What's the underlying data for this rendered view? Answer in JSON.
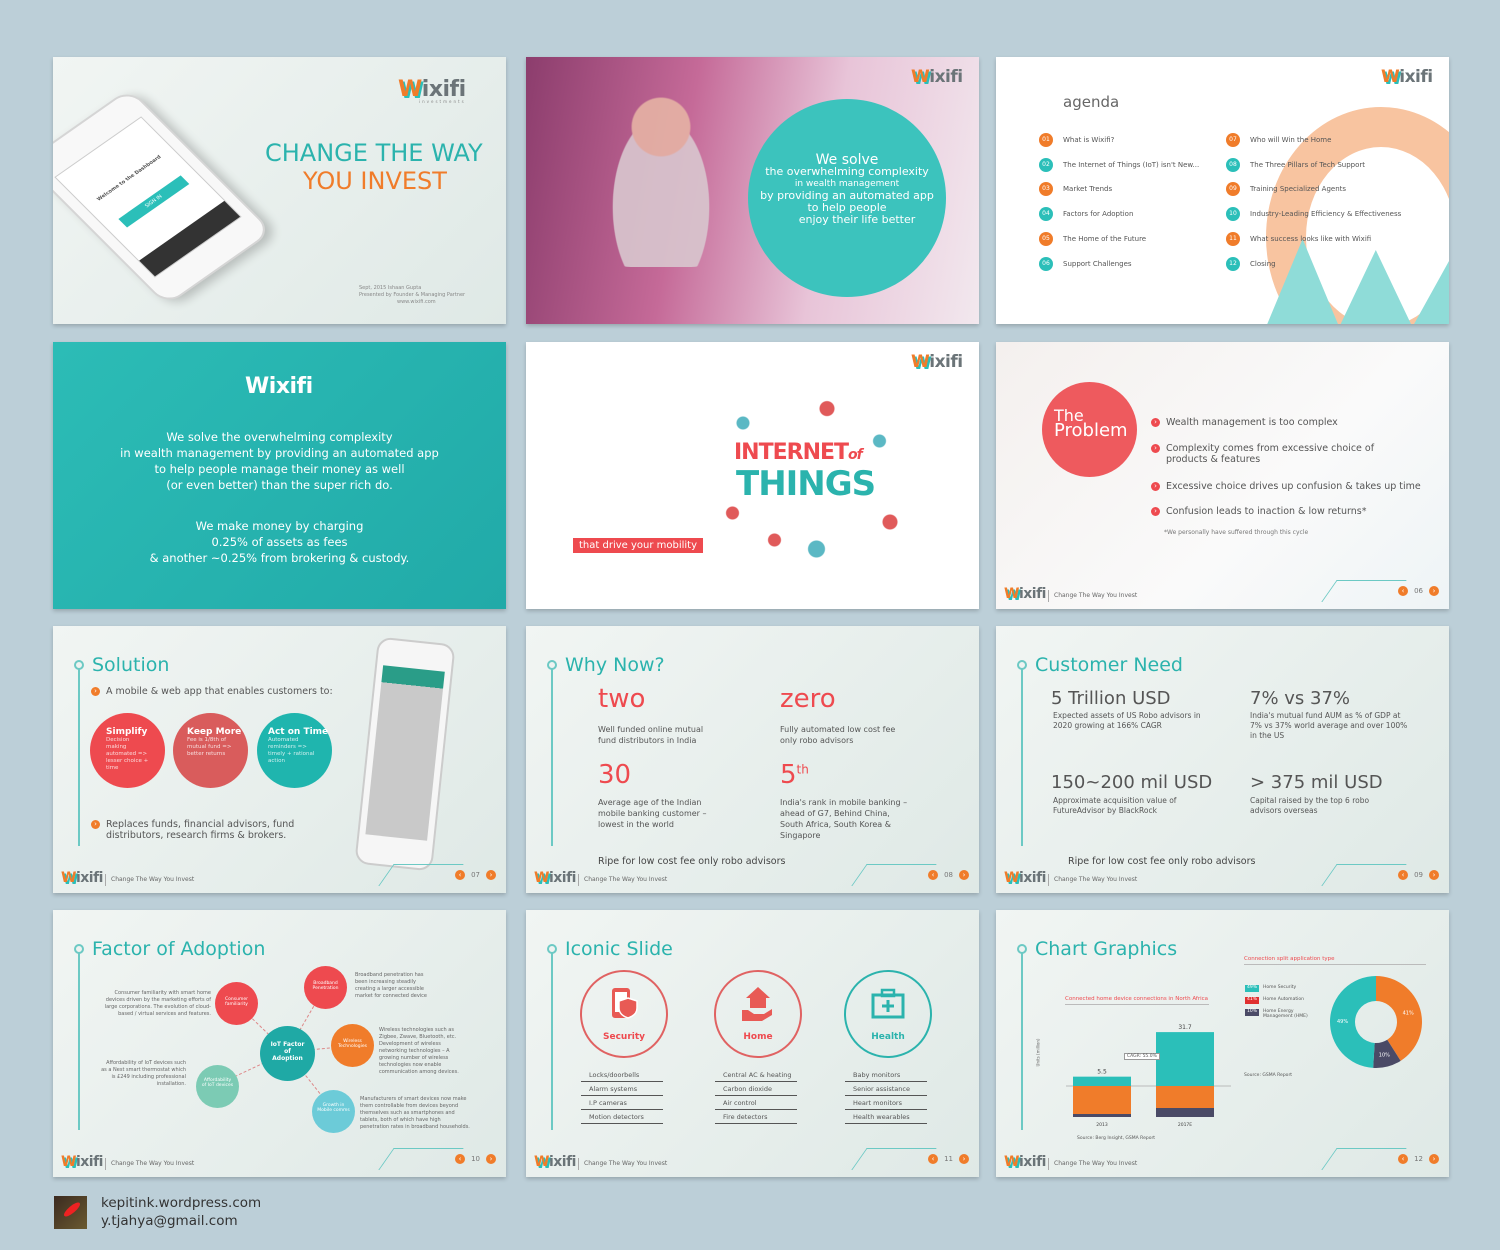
{
  "brand": {
    "logo_w": "W",
    "logo_rest": "ixifi",
    "logo_sub": "investments",
    "tagline": "Change The Way You Invest",
    "prev": "‹",
    "next": "›"
  },
  "colors": {
    "teal": "#2bb3ad",
    "orange": "#f07c2a",
    "red": "#ee4a4f",
    "navy": "#4a4a66"
  },
  "s1": {
    "title1": "CHANGE THE WAY",
    "title2": "YOU INVEST",
    "date": "Sept, 2015",
    "presented_by": "Presented by",
    "presenter": "Ishaan Gupta",
    "role": "Founder & Managing Partner",
    "url": "www.wixifi.com",
    "phone_welcome": "Welcome to the Dashboard",
    "phone_signin": "SIGN IN"
  },
  "s2": {
    "lines": [
      "We solve",
      "the overwhelming complexity",
      "in wealth management",
      "by providing an automated app",
      "to help people",
      "enjoy their life better"
    ]
  },
  "s3": {
    "title": "agenda",
    "items": [
      {
        "n": "01",
        "t": "What is Wixifi?"
      },
      {
        "n": "02",
        "t": "The Internet of Things (IoT) isn't New..."
      },
      {
        "n": "03",
        "t": "Market Trends"
      },
      {
        "n": "04",
        "t": "Factors for Adoption"
      },
      {
        "n": "05",
        "t": "The Home of the Future"
      },
      {
        "n": "06",
        "t": "Support Challenges"
      },
      {
        "n": "07",
        "t": "Who will Win the Home"
      },
      {
        "n": "08",
        "t": "The Three Pillars of Tech Support"
      },
      {
        "n": "09",
        "t": "Training Specialized Agents"
      },
      {
        "n": "10",
        "t": "Industry-Leading Efficiency & Effectiveness"
      },
      {
        "n": "11",
        "t": "What success looks like with Wixifi"
      },
      {
        "n": "12",
        "t": "Closing"
      }
    ]
  },
  "s4": {
    "p1": [
      "We solve the overwhelming complexity",
      "in wealth management by providing an automated app",
      "to help people manage their money as well",
      "(or even better) than the super rich do."
    ],
    "p2": [
      "We make money by charging",
      "0.25% of assets as fees",
      "& another ~0.25% from brokering & custody."
    ]
  },
  "s5": {
    "title1": "INTERNET",
    "title_of": "of",
    "title2": "THINGS",
    "label": "that drive your mobility"
  },
  "s6": {
    "circle1": "The",
    "circle2": "Problem",
    "bullets": [
      "Wealth management is too complex",
      "Complexity comes from excessive choice of products & features",
      "Excessive choice drives up confusion & takes up time",
      "Confusion leads to inaction & low returns*"
    ],
    "note": "*We personally have suffered through this cycle",
    "page": "06"
  },
  "s7": {
    "title": "Solution",
    "intro": "A mobile & web app that enables customers to:",
    "circles": [
      {
        "h": "Simplify",
        "d": "Decision making automated => lesser choice + time"
      },
      {
        "h": "Keep More",
        "d": "Fee is 1/8th of mutual fund => better returns"
      },
      {
        "h": "Act on Time",
        "d": "Automated reminders => timely + rational action"
      }
    ],
    "outro": "Replaces funds, financial advisors, fund distributors, research firms & brokers.",
    "page": "07"
  },
  "s8": {
    "title": "Why Now?",
    "stats": [
      {
        "v": "two",
        "d": "Well funded online mutual fund distributors in India"
      },
      {
        "v": "zero",
        "d": "Fully automated low cost fee only robo advisors"
      },
      {
        "v": "30",
        "d": "Average age of the Indian mobile banking customer – lowest in the world"
      },
      {
        "v": "5",
        "sup": "th",
        "d": "India's rank in mobile banking – ahead of G7, Behind China, South Africa, South Korea & Singapore"
      }
    ],
    "footer": "Ripe for low cost fee only robo advisors",
    "page": "08"
  },
  "s9": {
    "title": "Customer Need",
    "stats": [
      {
        "v": "5 Trillion USD",
        "d": "Expected assets of US Robo advisors in 2020 growing at 166% CAGR"
      },
      {
        "v": "7% vs 37%",
        "d": "India's mutual fund AUM as % of GDP at 7% vs 37% world average and over 100% in the US"
      },
      {
        "v": "150~200 mil USD",
        "d": "Approximate acquisition value of FutureAdvisor by BlackRock"
      },
      {
        "v": "> 375 mil USD",
        "d": "Capital raised by the top 6 robo advisors overseas"
      }
    ],
    "footer": "Ripe for low cost fee only robo advisors",
    "page": "09"
  },
  "s10": {
    "title": "Factor of Adoption",
    "center": "IoT Factor of Adoption",
    "nodes": [
      {
        "l": "Consumer familiarity",
        "d": "Consumer familiarity with smart home devices driven by the marketing efforts of large corporations. The evolution of cloud-based / virtual services and features."
      },
      {
        "l": "Broadband Penetration",
        "d": "Broadband penetration has been increasing steadily creating a larger accessible market for connected device"
      },
      {
        "l": "Wireless Technologies",
        "d": "Wireless technologies such as Zigbee, Zwave, Bluetooth, etc. Development of wireless networking technologies – A growing number of wireless technologies now enable communication among devices."
      },
      {
        "l": "Affordability of IoT devices",
        "d": "Affordability of IoT devices such as a Nest smart thermostat which is £249 including professional installation."
      },
      {
        "l": "Growth in Mobile comms",
        "d": "Manufacturers of smart devices now make them controllable from devices beyond themselves such as smartphones and tablets, both of which have high penetration rates in broadband households."
      }
    ],
    "page": "10"
  },
  "s11": {
    "title": "Iconic Slide",
    "groups": [
      {
        "l": "Security",
        "items": [
          "Locks/doorbells",
          "Alarm systems",
          "I.P cameras",
          "Motion detectors"
        ]
      },
      {
        "l": "Home",
        "items": [
          "Central AC & heating",
          "Carbon dioxide",
          "Air control",
          "Fire detectors"
        ]
      },
      {
        "l": "Health",
        "items": [
          "Baby monitors",
          "Senior assistance",
          "Heart monitors",
          "Health wearables"
        ]
      }
    ],
    "page": "11"
  },
  "s12": {
    "title": "Chart Graphics",
    "page": "12"
  },
  "chart_data": [
    {
      "type": "bar",
      "title": "Connected home device connections in North Africa",
      "ylabel": "Units (million)",
      "categories": [
        "2013",
        "2017E"
      ],
      "values": [
        5.5,
        31.7
      ],
      "annotation": "CAGR: 55.0%",
      "source": "Source: Berg Insight, GSMA Report"
    },
    {
      "type": "pie",
      "title": "Connection split application type",
      "labels": [
        "Home Security",
        "Home Automation",
        "Home Energy Management (HME)"
      ],
      "values": [
        49,
        41,
        10
      ],
      "value_labels": [
        "49%",
        "41%",
        "10%"
      ],
      "colors": [
        "#2bbfb9",
        "#f07c2a",
        "#4a4a66"
      ],
      "source": "Source: GSMA Report"
    }
  ],
  "credit": {
    "site": "kepitink.wordpress.com",
    "email": "y.tjahya@gmail.com"
  }
}
